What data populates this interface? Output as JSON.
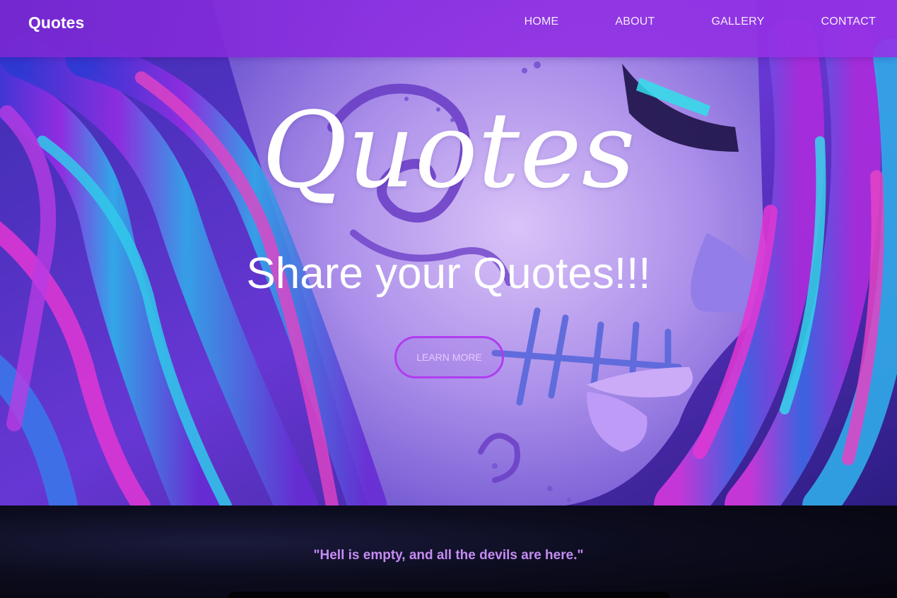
{
  "navbar": {
    "brand": "Quotes",
    "links": [
      "HOME",
      "ABOUT",
      "GALLERY",
      "CONTACT"
    ]
  },
  "hero": {
    "title": "Quotes",
    "subtitle": "Share your Quotes!!!",
    "cta_label": "LEARN MORE",
    "background_image": "neon sugar-skull portrait with blue and pink hair"
  },
  "quote_section": {
    "quote": "\"Hell is empty, and all the devils are here.\""
  },
  "colors": {
    "nav_background": "#8a2fe0",
    "accent": "#b03cf0",
    "quote_text": "#c58cf2",
    "dark_background": "#07060f"
  }
}
